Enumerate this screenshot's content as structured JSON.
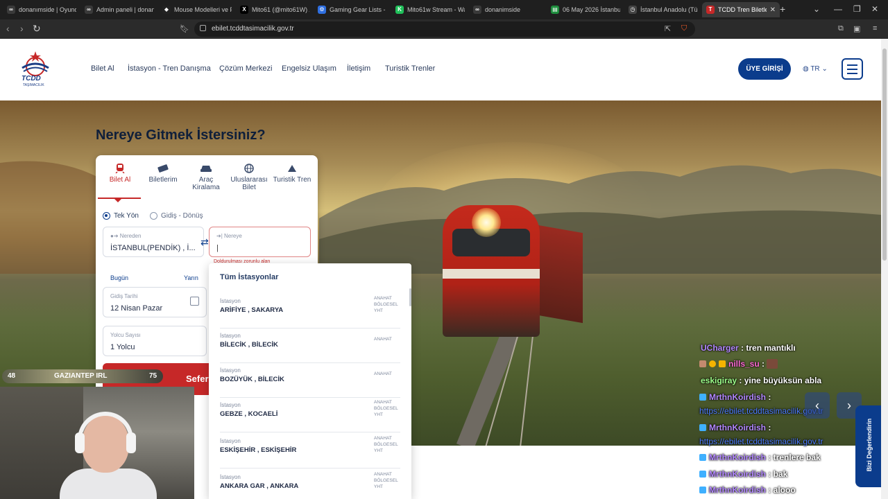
{
  "browser": {
    "tabs": [
      {
        "title": "donanımside | Oyuncu",
        "color": "#3a3a3a",
        "glyph": "∞"
      },
      {
        "title": "Admin paneli | donan",
        "color": "#3a3a3a",
        "glyph": "∞"
      },
      {
        "title": "Mouse Modelleri ve F",
        "color": "#222222",
        "glyph": "◆"
      },
      {
        "title": "Mito61 (@mito61W) /",
        "color": "#000000",
        "glyph": "X"
      },
      {
        "title": "Gaming Gear Lists - P",
        "color": "#2f6fe0",
        "glyph": "⚙"
      },
      {
        "title": "Mito61w Stream - Wa",
        "color": "#20c05a",
        "glyph": "K"
      },
      {
        "title": "donanimside",
        "color": "#3a3a3a",
        "glyph": "∞"
      },
      {
        "title": "06 May 2026 İstanbul",
        "color": "#1e8e3e",
        "glyph": "▤"
      },
      {
        "title": "İstanbul Anadolu (Tür",
        "color": "#444444",
        "glyph": "◷"
      },
      {
        "title": "TCDD Tren Biletle",
        "color": "#c62828",
        "glyph": "T"
      }
    ],
    "url": "ebilet.tcddtasimacilik.gov.tr"
  },
  "header": {
    "logo_text": "TCDD",
    "logo_sub": "TAŞIMACILIK",
    "nav": [
      "Bilet Al",
      "İstasyon - Tren Danışma",
      "Çözüm Merkezi",
      "Engelsiz Ulaşım",
      "İletişim",
      "Turistik Trenler"
    ],
    "login": "ÜYE GİRİŞİ",
    "lang": "TR"
  },
  "hero": {
    "title": "Nereye Gitmek İstersiniz?"
  },
  "panel": {
    "tabs": [
      "Bilet Al",
      "Biletlerim",
      "Araç Kiralama",
      "Uluslararası Bilet",
      "Turistik Tren"
    ],
    "trip_oneway": "Tek Yön",
    "trip_round": "Gidiş - Dönüş",
    "from_label": "Nereden",
    "from_value": "İSTANBUL(PENDİK) , İ...",
    "to_label": "Nereye",
    "to_value": "",
    "error": "Doldurulması zorunlu alan",
    "today": "Bugün",
    "tomorrow": "Yarın",
    "date_label": "Gidiş Tarihi",
    "date_value": "12 Nisan Pazar",
    "pax_label": "Yolcu Sayısı",
    "pax_value": "1 Yolcu",
    "search_btn": "Sefer"
  },
  "dropdown": {
    "heading": "Tüm İstasyonlar",
    "items": [
      {
        "kind": "İstasyon",
        "name": "ARİFİYE , SAKARYA",
        "type": "ANAHAT BÖLGESEL YHT"
      },
      {
        "kind": "İstasyon",
        "name": "BİLECİK , BİLECİK",
        "type": "ANAHAT"
      },
      {
        "kind": "İstasyon",
        "name": "BOZÜYÜK , BİLECİK",
        "type": "ANAHAT"
      },
      {
        "kind": "İstasyon",
        "name": "GEBZE , KOCAELİ",
        "type": "ANAHAT BÖLGESEL YHT"
      },
      {
        "kind": "İstasyon",
        "name": "ESKİŞEHİR , ESKİŞEHİR",
        "type": "ANAHAT BÖLGESEL YHT"
      },
      {
        "kind": "İstasyon",
        "name": "ANKARA GAR , ANKARA",
        "type": "ANAHAT BÖLGESEL YHT"
      }
    ]
  },
  "stream": {
    "left_num": "48",
    "label": "GAZIANTEP IRL",
    "right_num": "75"
  },
  "chat": [
    {
      "user": "UCharger",
      "sep": " : ",
      "msg": "tren mantıklı",
      "color": "#b388ff"
    },
    {
      "user": "nills_su",
      "sep": " : ",
      "msg": "",
      "color": "#ff6ad5"
    },
    {
      "user": "eskigiray",
      "sep": " : ",
      "msg": "yine büyüksün abla",
      "color": "#9dff8a"
    },
    {
      "user": "MrthnKoirdish",
      "sep": " :",
      "msg": "",
      "color": "#b388ff"
    },
    {
      "user": "",
      "sep": "",
      "msg": "https://ebilet.tcddtasimacilik.gov.tr",
      "color": "#4d7cff"
    },
    {
      "user": "MrthnKoirdish",
      "sep": " :",
      "msg": "",
      "color": "#b388ff"
    },
    {
      "user": "",
      "sep": "",
      "msg": "https://ebilet.tcddtasimacilik.gov.tr",
      "color": "#4d7cff"
    },
    {
      "user": "MrthnKoirdish",
      "sep": " : ",
      "msg": "trenlere bak",
      "color": "#b388ff"
    },
    {
      "user": "MrthnKoirdish",
      "sep": " : ",
      "msg": "bak",
      "color": "#b388ff"
    },
    {
      "user": "MrthnKoirdish",
      "sep": " : ",
      "msg": "alooo",
      "color": "#b388ff"
    }
  ],
  "feedback": "Bizi Değerlendirin"
}
